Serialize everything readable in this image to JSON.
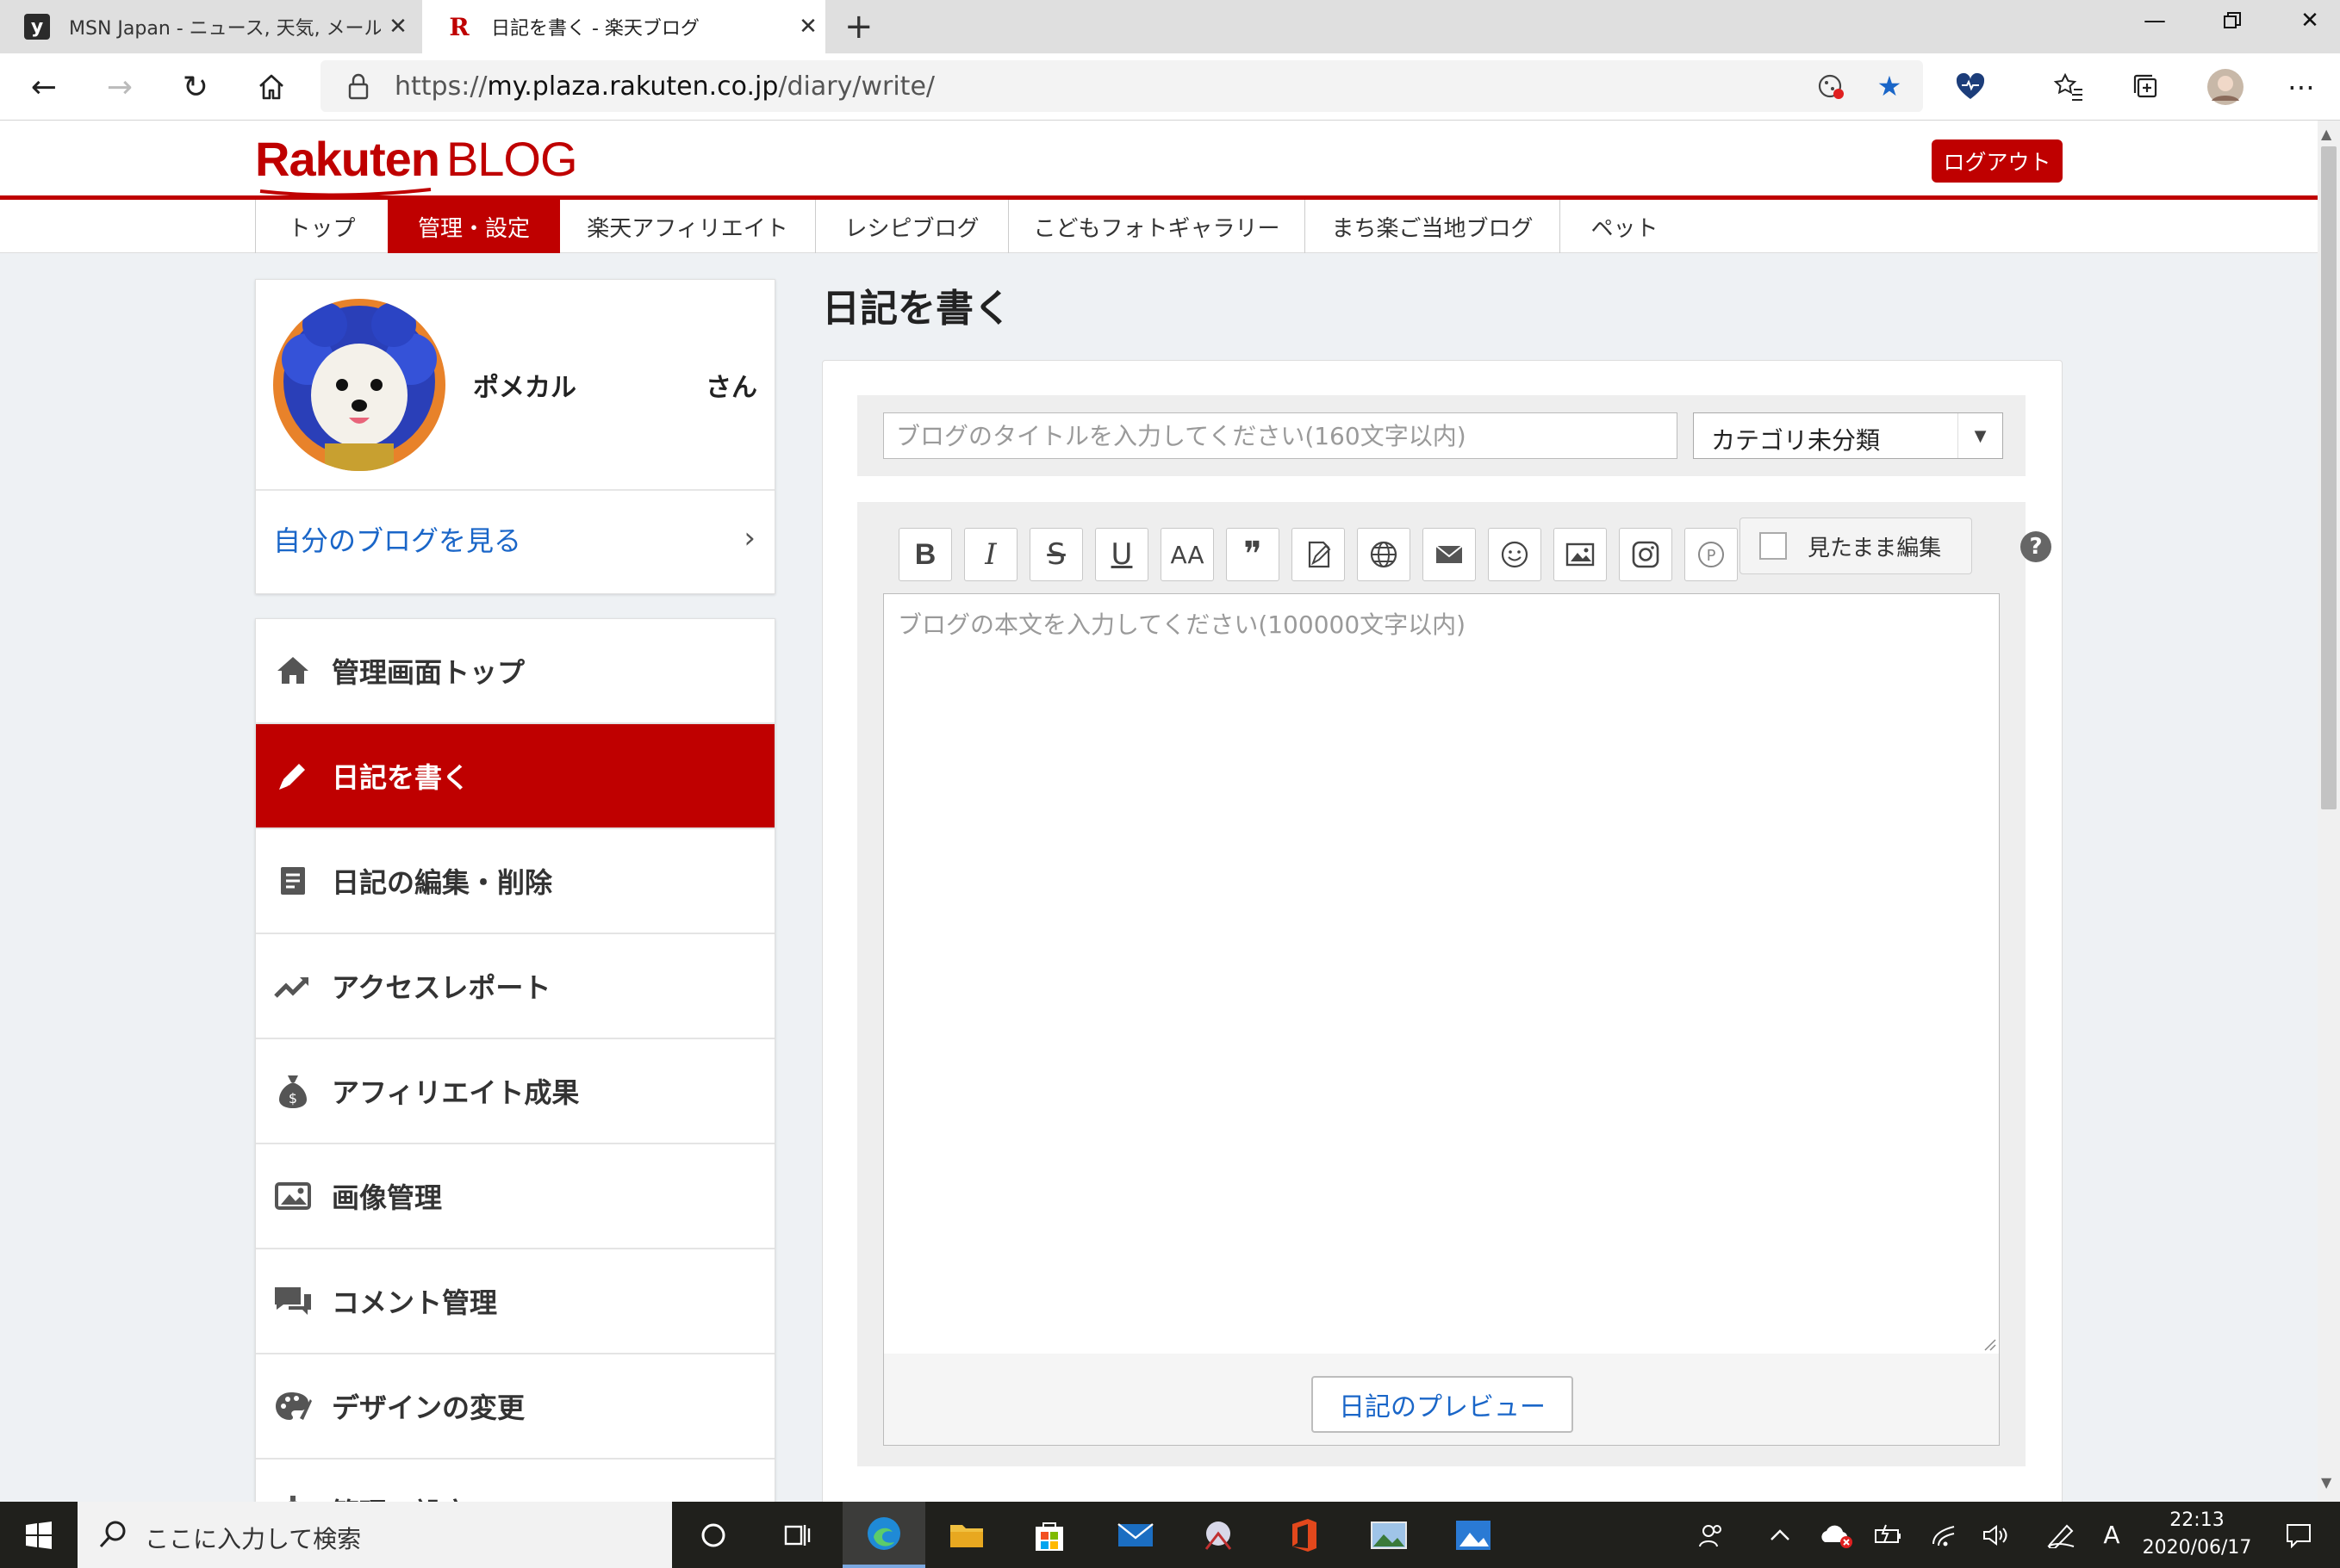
{
  "browser": {
    "tabs": [
      {
        "title": "MSN Japan - ニュース, 天気, メール (",
        "favicon": "y-logo-icon"
      },
      {
        "title": "日記を書く - 楽天ブログ",
        "favicon": "rakuten-r-icon"
      }
    ],
    "url_prefix": "https://",
    "url_domain": "my.plaza.rakuten.co.jp",
    "url_path": "/diary/write/"
  },
  "site": {
    "logo_text": "Rakuten",
    "logo_suffix": "BLOG",
    "logout_label": "ログアウト",
    "accent_color": "#bf0000",
    "nav": [
      {
        "label": "トップ",
        "active": false
      },
      {
        "label": "管理・設定",
        "active": true
      },
      {
        "label": "楽天アフィリエイト",
        "active": false
      },
      {
        "label": "レシピブログ",
        "active": false
      },
      {
        "label": "こどもフォトギャラリー",
        "active": false
      },
      {
        "label": "まち楽ご当地ブログ",
        "active": false
      },
      {
        "label": "ペット",
        "active": false
      }
    ]
  },
  "sidebar": {
    "username": "ポメカル",
    "honorific": "さん",
    "view_blog_label": "自分のブログを見る",
    "menu": [
      {
        "label": "管理画面トップ",
        "icon": "home-icon",
        "active": false
      },
      {
        "label": "日記を書く",
        "icon": "pencil-icon",
        "active": true
      },
      {
        "label": "日記の編集・削除",
        "icon": "document-icon",
        "active": false
      },
      {
        "label": "アクセスレポート",
        "icon": "trend-chart-icon",
        "active": false
      },
      {
        "label": "アフィリエイト成果",
        "icon": "money-bag-icon",
        "active": false
      },
      {
        "label": "画像管理",
        "icon": "image-icon",
        "active": false
      },
      {
        "label": "コメント管理",
        "icon": "comment-icon",
        "active": false
      },
      {
        "label": "デザインの変更",
        "icon": "palette-icon",
        "active": false
      },
      {
        "label": "管理・設定",
        "icon": "gear-icon",
        "active": false
      }
    ]
  },
  "main": {
    "page_title": "日記を書く",
    "title_placeholder": "ブログのタイトルを入力してください(160文字以内)",
    "category_value": "カテゴリ未分類",
    "toolbar": {
      "bold": "B",
      "italic": "I",
      "strike": "S",
      "underline": "U",
      "font_size": "AA",
      "quote": "❞",
      "photo_badge": "P",
      "wysiwyg_label": "見たまま編集",
      "help": "?"
    },
    "body_placeholder": "ブログの本文を入力してください(100000文字以内)",
    "preview_label": "日記のプレビュー"
  },
  "taskbar": {
    "search_placeholder": "ここに入力して検索",
    "ime_indicator": "A",
    "time": "22:13",
    "date": "2020/06/17"
  }
}
